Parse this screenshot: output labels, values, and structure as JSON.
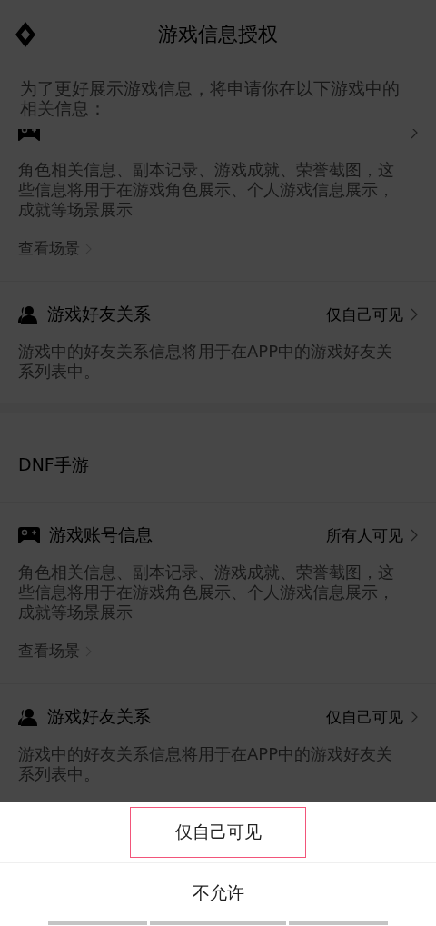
{
  "header": {
    "title": "游戏信息授权"
  },
  "intro": "为了更好展示游戏信息，将申请你在以下游戏中的相关信息：",
  "games": [
    {
      "permissions": [
        {
          "kind": "account",
          "description": "角色相关信息、副本记录、游戏成就、荣誉截图，这些信息将用于在游戏角色展示、个人游戏信息展示，成就等场景展示",
          "link": "查看场景"
        },
        {
          "kind": "friends",
          "title": "游戏好友关系",
          "visibility": "仅自己可见",
          "description": "游戏中的好友关系信息将用于在APP中的游戏好友关系列表中。"
        }
      ]
    },
    {
      "name": "DNF手游",
      "permissions": [
        {
          "kind": "account",
          "title": "游戏账号信息",
          "visibility": "所有人可见",
          "description": "角色相关信息、副本记录、游戏成就、荣誉截图，这些信息将用于在游戏角色展示、个人游戏信息展示，成就等场景展示",
          "link": "查看场景"
        },
        {
          "kind": "friends",
          "title": "游戏好友关系",
          "visibility": "仅自己可见",
          "description": "游戏中的好友关系信息将用于在APP中的游戏好友关系列表中。"
        }
      ]
    }
  ],
  "sheet": {
    "options": [
      {
        "label": "仅自己可见",
        "selected": true
      },
      {
        "label": "不允许",
        "selected": false
      }
    ]
  }
}
